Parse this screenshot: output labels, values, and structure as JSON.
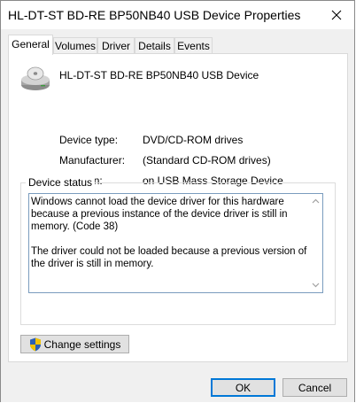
{
  "window": {
    "title": "HL-DT-ST BD-RE BP50NB40 USB Device Properties"
  },
  "tabs": [
    {
      "label": "General",
      "active": true
    },
    {
      "label": "Volumes",
      "active": false
    },
    {
      "label": "Driver",
      "active": false
    },
    {
      "label": "Details",
      "active": false
    },
    {
      "label": "Events",
      "active": false
    }
  ],
  "device": {
    "name": "HL-DT-ST BD-RE BP50NB40 USB Device",
    "icon": "optical-drive-icon",
    "properties": [
      {
        "label": "Device type:",
        "value": "DVD/CD-ROM drives"
      },
      {
        "label": "Manufacturer:",
        "value": "(Standard CD-ROM drives)"
      },
      {
        "label": "Location:",
        "value": "on USB Mass Storage Device"
      }
    ]
  },
  "status": {
    "legend": "Device status",
    "text": "Windows cannot load the device driver for this hardware because a previous instance of the device driver is still in memory. (Code 38)\n\nThe driver could not be loaded because a previous version of the driver is still in memory."
  },
  "buttons": {
    "change_settings": "Change settings",
    "ok": "OK",
    "cancel": "Cancel"
  },
  "colors": {
    "accent": "#0078d7",
    "client_bg": "#f0f0f0",
    "button_bg": "#e1e1e1"
  }
}
